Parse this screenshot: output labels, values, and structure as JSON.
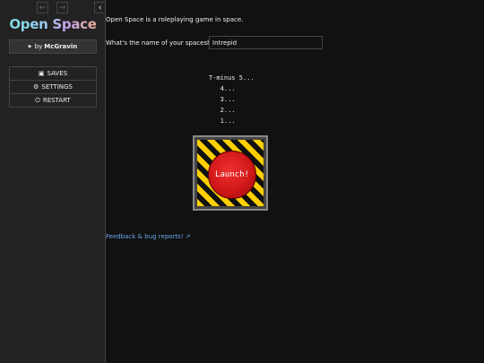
{
  "sidebar": {
    "history_back_icon": "arrow-left-icon",
    "history_forward_icon": "arrow-right-icon",
    "toggle_icon": "chevron-left-icon",
    "title": "Open Space",
    "author_prefix": "by",
    "author_name": "McGravin",
    "menu": [
      {
        "label": "SAVES",
        "icon": "floppy-disk-icon"
      },
      {
        "label": "SETTINGS",
        "icon": "gear-icon"
      },
      {
        "label": "RESTART",
        "icon": "power-icon"
      }
    ]
  },
  "passage": {
    "intro": "Open Space is a roleplaying game in space.",
    "ship_question": "What's the name of your spaceship?",
    "ship_name_value": "Intrepid",
    "countdown": [
      "T-minus 5...",
      "   4...",
      "   3...",
      "   2...",
      "   1..."
    ],
    "launch_label": "Launch!",
    "feedback_link": "Feedback & bug reports!"
  },
  "colors": {
    "background": "#111111",
    "sidebar": "#222222",
    "link": "#68a8e8",
    "hazard_yellow": "#ffd000",
    "button_red": "#d01818"
  }
}
